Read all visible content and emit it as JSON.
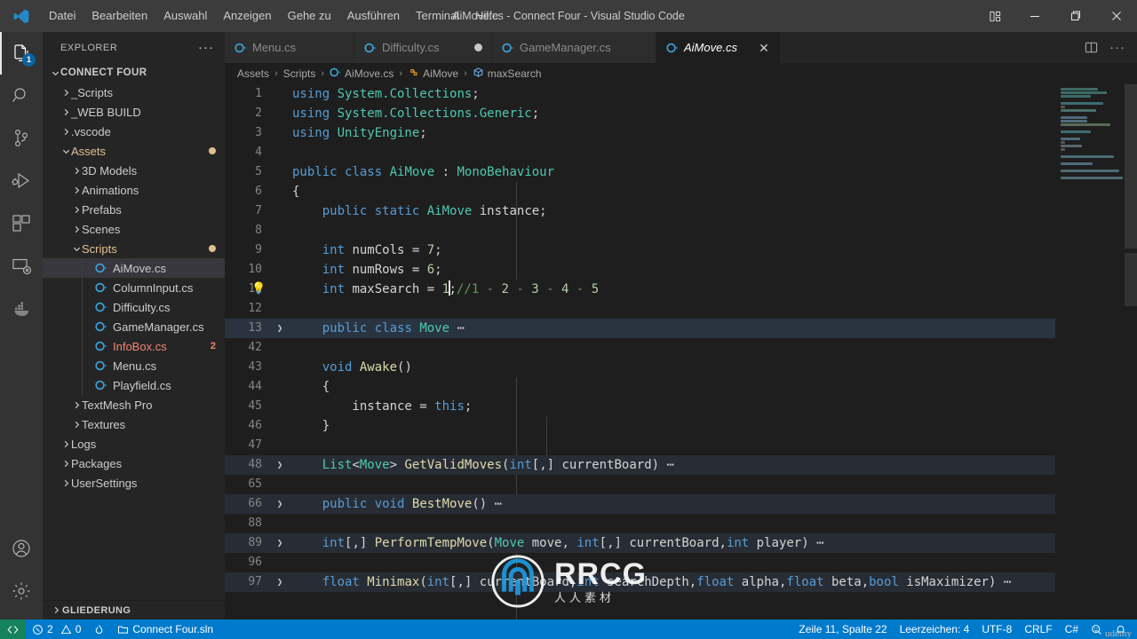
{
  "window": {
    "title": "AiMove.cs - Connect Four - Visual Studio Code",
    "logo_icon": "vscode-logo-icon",
    "minimize_icon": "minimize-icon",
    "maximize_icon": "maximize-restore-icon",
    "close_icon": "close-icon",
    "layout_icon": "customize-layout-icon"
  },
  "menu": {
    "items": [
      {
        "label": "Datei"
      },
      {
        "label": "Bearbeiten"
      },
      {
        "label": "Auswahl"
      },
      {
        "label": "Anzeigen"
      },
      {
        "label": "Gehe zu"
      },
      {
        "label": "Ausführen"
      },
      {
        "label": "Terminal"
      },
      {
        "label": "Hilfe"
      }
    ]
  },
  "activitybar": {
    "items": [
      {
        "name": "explorer",
        "icon": "files-icon",
        "badge": "1",
        "active": true
      },
      {
        "name": "search",
        "icon": "search-icon",
        "badge": "",
        "active": false
      },
      {
        "name": "source-control",
        "icon": "source-control-icon",
        "badge": "",
        "active": false
      },
      {
        "name": "run-and-debug",
        "icon": "run-debug-icon",
        "badge": "",
        "active": false
      },
      {
        "name": "extensions",
        "icon": "extensions-icon",
        "badge": "",
        "active": false
      },
      {
        "name": "remote-explorer",
        "icon": "remote-explorer-icon",
        "badge": "",
        "active": false
      },
      {
        "name": "docker",
        "icon": "docker-whale-icon",
        "badge": "",
        "active": false
      }
    ],
    "bottom": [
      {
        "name": "accounts",
        "icon": "account-icon"
      },
      {
        "name": "manage",
        "icon": "gear-icon"
      }
    ]
  },
  "sidebar": {
    "header": "EXPLORER",
    "more_icon": "more-actions-icon",
    "outline_section": "GLIEDERUNG",
    "tree": [
      {
        "label": "CONNECT FOUR",
        "indent": 0,
        "kind": "root",
        "twisty": "down"
      },
      {
        "label": "_Scripts",
        "indent": 1,
        "kind": "folder",
        "twisty": "right"
      },
      {
        "label": "_WEB BUILD",
        "indent": 1,
        "kind": "folder",
        "twisty": "right"
      },
      {
        "label": ".vscode",
        "indent": 1,
        "kind": "folder",
        "twisty": "right"
      },
      {
        "label": "Assets",
        "indent": 1,
        "kind": "folder-modified",
        "twisty": "down",
        "dot": true
      },
      {
        "label": "3D Models",
        "indent": 2,
        "kind": "folder",
        "twisty": "right"
      },
      {
        "label": "Animations",
        "indent": 2,
        "kind": "folder",
        "twisty": "right"
      },
      {
        "label": "Prefabs",
        "indent": 2,
        "kind": "folder",
        "twisty": "right"
      },
      {
        "label": "Scenes",
        "indent": 2,
        "kind": "folder",
        "twisty": "right"
      },
      {
        "label": "Scripts",
        "indent": 2,
        "kind": "folder-modified",
        "twisty": "down",
        "dot": true
      },
      {
        "label": "AiMove.cs",
        "indent": 3,
        "kind": "csfile",
        "selected": true
      },
      {
        "label": "ColumnInput.cs",
        "indent": 3,
        "kind": "csfile"
      },
      {
        "label": "Difficulty.cs",
        "indent": 3,
        "kind": "csfile"
      },
      {
        "label": "GameManager.cs",
        "indent": 3,
        "kind": "csfile"
      },
      {
        "label": "InfoBox.cs",
        "indent": 3,
        "kind": "csfile-error",
        "count": "2"
      },
      {
        "label": "Menu.cs",
        "indent": 3,
        "kind": "csfile"
      },
      {
        "label": "Playfield.cs",
        "indent": 3,
        "kind": "csfile"
      },
      {
        "label": "TextMesh Pro",
        "indent": 2,
        "kind": "folder",
        "twisty": "right"
      },
      {
        "label": "Textures",
        "indent": 2,
        "kind": "folder",
        "twisty": "right"
      },
      {
        "label": "Logs",
        "indent": 1,
        "kind": "folder",
        "twisty": "right"
      },
      {
        "label": "Packages",
        "indent": 1,
        "kind": "folder",
        "twisty": "right"
      },
      {
        "label": "UserSettings",
        "indent": 1,
        "kind": "folder",
        "twisty": "right"
      }
    ]
  },
  "tabs": {
    "items": [
      {
        "label": "Menu.cs",
        "icon": "csharp-icon",
        "active": false,
        "dirty": false,
        "close": false
      },
      {
        "label": "Difficulty.cs",
        "icon": "csharp-icon",
        "active": false,
        "dirty": true,
        "close": false
      },
      {
        "label": "GameManager.cs",
        "icon": "csharp-icon",
        "active": false,
        "dirty": false,
        "close": false
      },
      {
        "label": "AiMove.cs",
        "icon": "csharp-icon",
        "active": true,
        "dirty": false,
        "close": true
      }
    ],
    "split_icon": "split-editor-icon",
    "more_icon": "more-actions-icon",
    "close_glyph": "✕"
  },
  "breadcrumb": {
    "parts": [
      {
        "label": "Assets",
        "icon": ""
      },
      {
        "label": "Scripts",
        "icon": ""
      },
      {
        "label": "AiMove.cs",
        "icon": "csharp-icon"
      },
      {
        "label": "AiMove",
        "icon": "class-symbol-icon"
      },
      {
        "label": "maxSearch",
        "icon": "field-symbol-icon"
      }
    ],
    "separator": "›"
  },
  "code": {
    "lines": [
      {
        "n": "1",
        "tokens": [
          {
            "t": "using ",
            "c": "k"
          },
          {
            "t": "System.Collections",
            "c": "t"
          },
          {
            "t": ";",
            "c": "p"
          }
        ]
      },
      {
        "n": "2",
        "tokens": [
          {
            "t": "using ",
            "c": "k"
          },
          {
            "t": "System.Collections.Generic",
            "c": "t"
          },
          {
            "t": ";",
            "c": "p"
          }
        ]
      },
      {
        "n": "3",
        "tokens": [
          {
            "t": "using ",
            "c": "k"
          },
          {
            "t": "UnityEngine",
            "c": "t"
          },
          {
            "t": ";",
            "c": "p"
          }
        ]
      },
      {
        "n": "4",
        "tokens": []
      },
      {
        "n": "5",
        "tokens": [
          {
            "t": "public ",
            "c": "k"
          },
          {
            "t": "class ",
            "c": "k"
          },
          {
            "t": "AiMove",
            "c": "t"
          },
          {
            "t": " : ",
            "c": "p"
          },
          {
            "t": "MonoBehaviour",
            "c": "t"
          }
        ]
      },
      {
        "n": "6",
        "tokens": [
          {
            "t": "{",
            "c": "p"
          }
        ]
      },
      {
        "n": "7",
        "tokens": [
          {
            "t": "    ",
            "c": "p"
          },
          {
            "t": "public ",
            "c": "k"
          },
          {
            "t": "static ",
            "c": "k"
          },
          {
            "t": "AiMove",
            "c": "t"
          },
          {
            "t": " instance;",
            "c": "p"
          }
        ]
      },
      {
        "n": "8",
        "tokens": []
      },
      {
        "n": "9",
        "tokens": [
          {
            "t": "    ",
            "c": "p"
          },
          {
            "t": "int",
            "c": "k"
          },
          {
            "t": " numCols = ",
            "c": "p"
          },
          {
            "t": "7",
            "c": "n"
          },
          {
            "t": ";",
            "c": "p"
          }
        ]
      },
      {
        "n": "10",
        "tokens": [
          {
            "t": "    ",
            "c": "p"
          },
          {
            "t": "int",
            "c": "k"
          },
          {
            "t": " numRows = ",
            "c": "p"
          },
          {
            "t": "6",
            "c": "n"
          },
          {
            "t": ";",
            "c": "p"
          }
        ]
      },
      {
        "n": "11",
        "bulb": true,
        "caret_after": 6,
        "tokens": [
          {
            "t": "    ",
            "c": "p"
          },
          {
            "t": "int",
            "c": "k"
          },
          {
            "t": " maxSearch = ",
            "c": "p"
          },
          {
            "t": "1",
            "c": "n"
          },
          {
            "t": ";",
            "c": "p"
          },
          {
            "t": "//1 - ",
            "c": "c"
          },
          {
            "t": "2",
            "c": "n"
          },
          {
            "t": " - ",
            "c": "c"
          },
          {
            "t": "3",
            "c": "n"
          },
          {
            "t": " - ",
            "c": "c"
          },
          {
            "t": "4",
            "c": "n"
          },
          {
            "t": " - ",
            "c": "c"
          },
          {
            "t": "5",
            "c": "n"
          }
        ]
      },
      {
        "n": "12",
        "tokens": []
      },
      {
        "n": "13",
        "folded": true,
        "highlight": true,
        "tokens": [
          {
            "t": "    ",
            "c": "p"
          },
          {
            "t": "public ",
            "c": "k"
          },
          {
            "t": "class ",
            "c": "k"
          },
          {
            "t": "Move",
            "c": "t"
          },
          {
            "t": "⋯",
            "c": "p"
          }
        ]
      },
      {
        "n": "42",
        "tokens": []
      },
      {
        "n": "43",
        "tokens": [
          {
            "t": "    ",
            "c": "p"
          },
          {
            "t": "void ",
            "c": "k"
          },
          {
            "t": "Awake",
            "c": "f"
          },
          {
            "t": "()",
            "c": "p"
          }
        ]
      },
      {
        "n": "44",
        "tokens": [
          {
            "t": "    {",
            "c": "p"
          }
        ]
      },
      {
        "n": "45",
        "tokens": [
          {
            "t": "        instance = ",
            "c": "p"
          },
          {
            "t": "this",
            "c": "k"
          },
          {
            "t": ";",
            "c": "p"
          }
        ]
      },
      {
        "n": "46",
        "tokens": [
          {
            "t": "    }",
            "c": "p"
          }
        ]
      },
      {
        "n": "47",
        "tokens": []
      },
      {
        "n": "48",
        "folded": true,
        "tokens": [
          {
            "t": "    ",
            "c": "p"
          },
          {
            "t": "List",
            "c": "t"
          },
          {
            "t": "<",
            "c": "p"
          },
          {
            "t": "Move",
            "c": "t"
          },
          {
            "t": "> ",
            "c": "p"
          },
          {
            "t": "GetValidMoves",
            "c": "f"
          },
          {
            "t": "(",
            "c": "p"
          },
          {
            "t": "int",
            "c": "k"
          },
          {
            "t": "[,] currentBoard)",
            "c": "p"
          },
          {
            "t": "⋯",
            "c": "p"
          }
        ]
      },
      {
        "n": "65",
        "tokens": []
      },
      {
        "n": "66",
        "folded": true,
        "tokens": [
          {
            "t": "    ",
            "c": "p"
          },
          {
            "t": "public ",
            "c": "k"
          },
          {
            "t": "void ",
            "c": "k"
          },
          {
            "t": "BestMove",
            "c": "f"
          },
          {
            "t": "()",
            "c": "p"
          },
          {
            "t": "⋯",
            "c": "p"
          }
        ]
      },
      {
        "n": "88",
        "tokens": []
      },
      {
        "n": "89",
        "folded": true,
        "tokens": [
          {
            "t": "    ",
            "c": "p"
          },
          {
            "t": "int",
            "c": "k"
          },
          {
            "t": "[,] ",
            "c": "p"
          },
          {
            "t": "PerformTempMove",
            "c": "f"
          },
          {
            "t": "(",
            "c": "p"
          },
          {
            "t": "Move",
            "c": "t"
          },
          {
            "t": " move, ",
            "c": "p"
          },
          {
            "t": "int",
            "c": "k"
          },
          {
            "t": "[,] currentBoard,",
            "c": "p"
          },
          {
            "t": "int",
            "c": "k"
          },
          {
            "t": " player)",
            "c": "p"
          },
          {
            "t": "⋯",
            "c": "p"
          }
        ]
      },
      {
        "n": "96",
        "tokens": []
      },
      {
        "n": "97",
        "folded": true,
        "tokens": [
          {
            "t": "    ",
            "c": "p"
          },
          {
            "t": "float ",
            "c": "k"
          },
          {
            "t": "Minimax",
            "c": "f"
          },
          {
            "t": "(",
            "c": "p"
          },
          {
            "t": "int",
            "c": "k"
          },
          {
            "t": "[,] currentBoard,",
            "c": "p"
          },
          {
            "t": "int",
            "c": "k"
          },
          {
            "t": " searchDepth,",
            "c": "p"
          },
          {
            "t": "float",
            "c": "k"
          },
          {
            "t": " alpha,",
            "c": "p"
          },
          {
            "t": "float",
            "c": "k"
          },
          {
            "t": " beta,",
            "c": "p"
          },
          {
            "t": "bool",
            "c": "k"
          },
          {
            "t": " isMaximizer)",
            "c": "p"
          },
          {
            "t": "⋯",
            "c": "p"
          }
        ]
      }
    ]
  },
  "statusbar": {
    "remote_icon": "remote-window-icon",
    "errors_icon": "error-circle-icon",
    "errors": "2",
    "warnings_icon": "warning-triangle-icon",
    "warnings": "0",
    "flame_icon": "radon-flame-icon",
    "solution_icon": "folder-icon",
    "solution": "Connect Four.sln",
    "position": "Zeile 11, Spalte 22",
    "indentation": "Leerzeichen: 4",
    "encoding": "UTF-8",
    "eol": "CRLF",
    "language": "C#",
    "feedback_icon": "feedback-smiley-icon",
    "bell_icon": "notifications-bell-icon"
  },
  "watermark": {
    "big": "RRCG",
    "small": "人人素材",
    "corner": "udemy"
  },
  "colors": {
    "accent": "#007acc",
    "remote": "#16825d",
    "titlebar": "#3c3c3c",
    "sidebar": "#252526",
    "editor": "#1e1e1e",
    "modified": "#e2c08d",
    "error": "#f48771",
    "badge": "#0e639c"
  }
}
